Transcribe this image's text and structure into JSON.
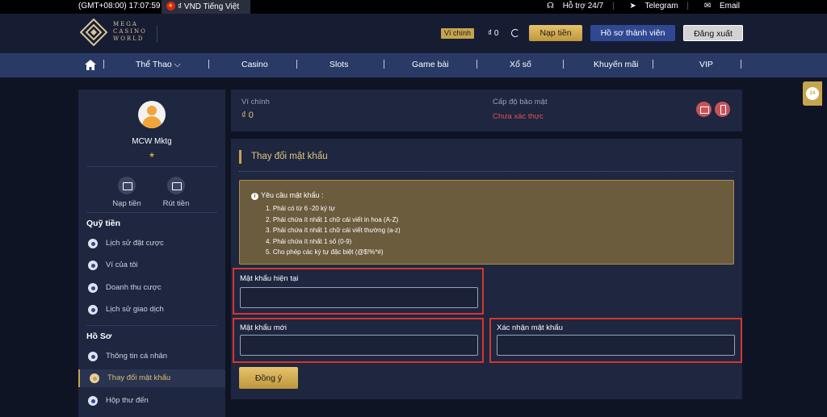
{
  "topbar": {
    "time": "(GMT+08:00) 17:07:59",
    "currency_lang": "₫ VND Tiếng Việt",
    "support": "Hỗ trợ 24/7",
    "telegram": "Telegram",
    "email": "Email"
  },
  "header": {
    "logo_line1": "MEGA",
    "logo_line2": "CASINO",
    "logo_line3": "WORLD",
    "wallet_badge": "Ví chính",
    "balance": "₫ 0",
    "deposit_button": "Nạp tiền",
    "profile_button": "Hồ sơ thành viên",
    "logout_button": "Đăng xuất"
  },
  "nav": {
    "items": [
      "Thể Thao",
      "Casino",
      "Slots",
      "Game bài",
      "Xổ số",
      "Khuyến mãi",
      "VIP"
    ]
  },
  "sidebar": {
    "username": "MCW Mktg",
    "star": "★",
    "deposit": "Nạp tiền",
    "withdraw": "Rút tiền",
    "section_funds": "Quỹ tiền",
    "funds_items": [
      "Lịch sử đặt cược",
      "Ví của tôi",
      "Doanh thu cược",
      "Lịch sử giao dịch"
    ],
    "section_profile": "Hồ Sơ",
    "profile_items": [
      "Thông tin cá nhân",
      "Thay đổi mật khẩu",
      "Hộp thư đến"
    ]
  },
  "wallet_panel": {
    "main_wallet_label": "Ví chính",
    "main_wallet_value": "₫ 0",
    "security_label": "Cấp độ bảo mật",
    "security_value": "Chưa xác thực"
  },
  "form": {
    "title": "Thay đổi mật khẩu",
    "requirements_title": "Yêu cầu mật khẩu :",
    "requirements": [
      "1. Phải có từ 6 -20 ký tự",
      "2. Phải chứa ít nhất 1 chữ cái viết in hoa (A-Z)",
      "3. Phải chứa ít nhất 1 chữ cái viết thường (a-z)",
      "4. Phải chứa ít nhất 1 số (0-9)",
      "5. Cho phép các ký tự đặc biệt (@$!%*#)"
    ],
    "current_password_label": "Mật khẩu hiện tại",
    "current_password_value": "",
    "new_password_label": "Mật khẩu mới",
    "new_password_value": "",
    "confirm_password_label": "Xác nhận mật khẩu",
    "confirm_password_value": "",
    "submit_button": "Đồng ý"
  },
  "float": {
    "badge": "24"
  },
  "colors": {
    "accent_gold": "#c6a44d",
    "highlight_red": "#d6362c",
    "nav_bg": "#2a3a66"
  }
}
